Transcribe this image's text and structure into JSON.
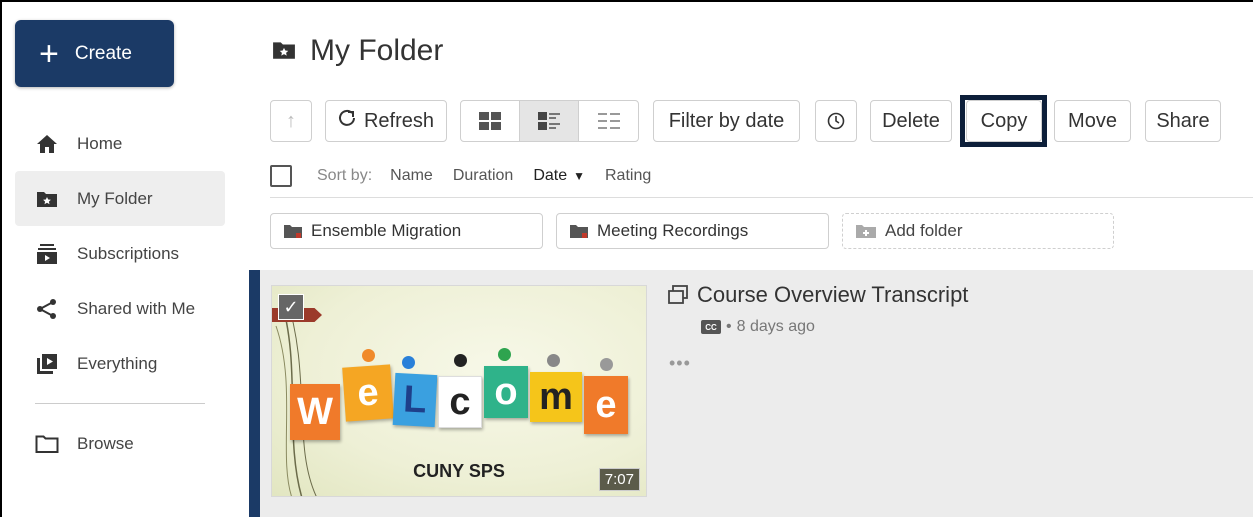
{
  "sidebar": {
    "create_label": "Create",
    "items": [
      {
        "label": "Home",
        "icon": "home-icon"
      },
      {
        "label": "My Folder",
        "icon": "starred-folder-icon"
      },
      {
        "label": "Subscriptions",
        "icon": "subscriptions-icon"
      },
      {
        "label": "Shared with Me",
        "icon": "share-icon"
      },
      {
        "label": "Everything",
        "icon": "everything-icon"
      },
      {
        "label": "Browse",
        "icon": "folder-icon"
      }
    ]
  },
  "header": {
    "title": "My Folder"
  },
  "toolbar": {
    "refresh_label": "Refresh",
    "filter_label": "Filter by date",
    "delete_label": "Delete",
    "copy_label": "Copy",
    "move_label": "Move",
    "share_label": "Share"
  },
  "sort": {
    "label": "Sort by:",
    "options": [
      "Name",
      "Duration",
      "Date",
      "Rating"
    ],
    "active": "Date"
  },
  "folders": [
    {
      "label": "Ensemble Migration"
    },
    {
      "label": "Meeting Recordings"
    }
  ],
  "add_folder_label": "Add folder",
  "media": {
    "title": "Course Overview Transcript",
    "age": "8 days ago",
    "more": "•••",
    "thumbnail_subtitle": "CUNY SPS",
    "duration": "7:07",
    "welcome_letters": [
      "W",
      "e",
      "L",
      "c",
      "o",
      "m",
      "e"
    ]
  },
  "colors": {
    "brand_navy": "#1b3a66",
    "highlight_border": "#0d1f3a"
  }
}
